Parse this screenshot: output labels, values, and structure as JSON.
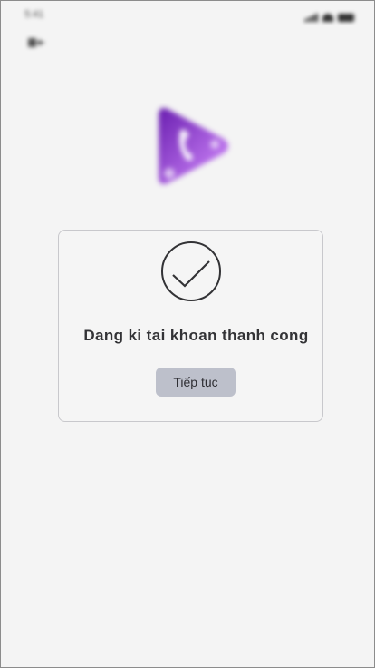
{
  "status_bar": {
    "time": "5:41"
  },
  "dialog": {
    "message": "Dang ki tai khoan thanh cong",
    "continue_label": "Tiếp tục"
  },
  "colors": {
    "background": "#f4f4f4",
    "dialog_background": "#f5f5f5",
    "button_background": "#bdc0cb",
    "text": "#333336",
    "logo_gradient_start": "#7b2cbf",
    "logo_gradient_end": "#c77dff"
  },
  "icons": {
    "back": "back-arrow-icon",
    "logo": "play-phone-logo-icon",
    "success": "checkmark-circle-icon"
  }
}
